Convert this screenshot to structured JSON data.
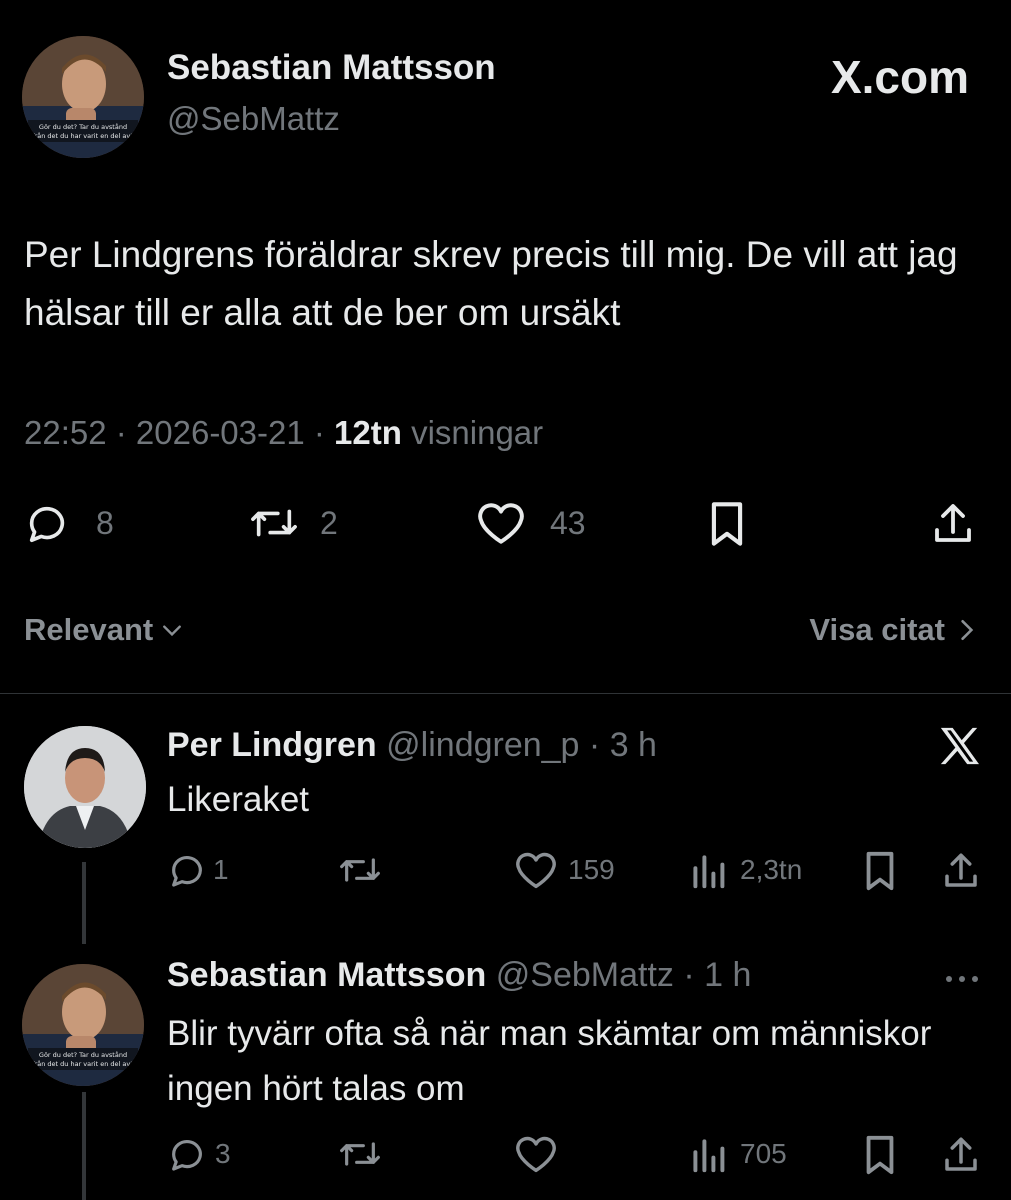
{
  "main": {
    "author_name": "Sebastian Mattsson",
    "author_handle": "@SebMattz",
    "brand": "X.com",
    "text": "Per Lindgrens föräldrar skrev precis till mig. De vill att jag hälsar till er alla att de ber om ursäkt",
    "time_date": "22:52 · 2026-03-21 · ",
    "views_count": "12tn",
    "views_label": " visningar",
    "replies": "8",
    "reposts": "2",
    "likes": "43",
    "avatar_caption_1": "Gör du det? Tar du avstånd",
    "avatar_caption_2": "från det du har varit en del av?"
  },
  "toolbar": {
    "sort_label": "Relevant",
    "quotes_label": "Visa citat"
  },
  "replies": [
    {
      "name": "Per Lindgren",
      "handle": "@lindgren_p",
      "time": "· 3 h",
      "text": "Likeraket",
      "replies": "1",
      "reposts": "",
      "likes": "159",
      "views": "2,3tn"
    },
    {
      "name": "Sebastian Mattsson",
      "handle": "@SebMattz",
      "time": "· 1 h",
      "text": "Blir tyvärr ofta så när man skämtar om människor ingen hört talas om",
      "replies": "3",
      "reposts": "",
      "likes": "",
      "views": "705"
    }
  ],
  "colors": {
    "background": "#000000",
    "text": "#e7e9ea",
    "muted": "#71767b"
  },
  "icons": [
    "reply-icon",
    "repost-icon",
    "like-icon",
    "bookmark-icon",
    "share-icon",
    "views-icon",
    "x-logo-icon",
    "more-icon",
    "chevron-down-icon",
    "chevron-right-icon"
  ]
}
